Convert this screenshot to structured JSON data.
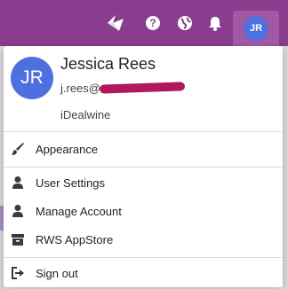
{
  "user": {
    "initials": "JR",
    "name": "Jessica Rees",
    "email": "j.rees@",
    "organization": "iDealwine"
  },
  "topbar": {
    "icons": [
      "logo-icon",
      "help-icon",
      "globe-icon",
      "bell-icon"
    ]
  },
  "menu": {
    "items": [
      {
        "label": "Appearance",
        "icon": "paintbrush-icon"
      },
      {
        "label": "User Settings",
        "icon": "user-icon"
      },
      {
        "label": "Manage Account",
        "icon": "user-icon"
      },
      {
        "label": "RWS AppStore",
        "icon": "archive-box-icon"
      },
      {
        "label": "Sign out",
        "icon": "sign-out-icon"
      }
    ]
  },
  "colors": {
    "header_bg": "#8a3c8e",
    "avatar_bg": "#4f6ee0",
    "redaction": "#b0185c"
  }
}
